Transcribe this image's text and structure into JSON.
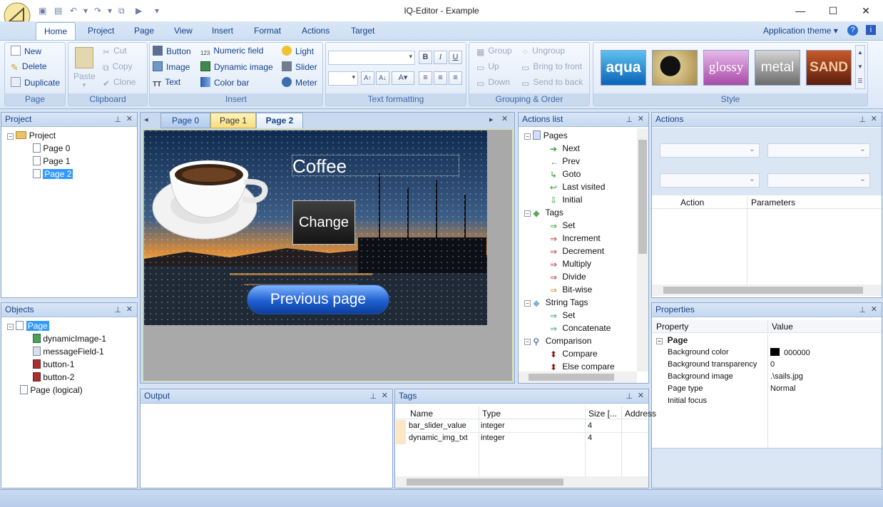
{
  "window": {
    "title": "IQ-Editor - Example",
    "min": "—",
    "max": "☐",
    "close": "✕"
  },
  "ribbon_tabs": [
    "Home",
    "Project",
    "Page",
    "View",
    "Insert",
    "Format",
    "Actions",
    "Target"
  ],
  "app_theme": "Application theme",
  "page_group": {
    "caption": "Page",
    "new": "New",
    "delete": "Delete",
    "duplicate": "Duplicate"
  },
  "clipboard_group": {
    "caption": "Clipboard",
    "paste": "Paste",
    "cut": "Cut",
    "copy": "Copy",
    "clone": "Clone"
  },
  "insert_group": {
    "caption": "Insert",
    "button": "Button",
    "image": "Image",
    "text": "Text",
    "numeric_field": "Numeric field",
    "dynamic_image": "Dynamic image",
    "color_bar": "Color bar",
    "light": "Light",
    "slider": "Slider",
    "meter": "Meter"
  },
  "text_format_group": {
    "caption": "Text formatting",
    "bold": "B",
    "italic": "I",
    "underline": "U"
  },
  "grouping_group": {
    "caption": "Grouping & Order",
    "group": "Group",
    "ungroup": "Ungroup",
    "up": "Up",
    "bring_to_front": "Bring to front",
    "down": "Down",
    "send_to_back": "Send to back"
  },
  "style_group": {
    "caption": "Style",
    "swatches": [
      "aqua",
      "",
      "glossy",
      "metal",
      "SAND"
    ]
  },
  "project_panel": {
    "title": "Project",
    "root": "Project",
    "pages": [
      "Page 0",
      "Page 1",
      "Page 2"
    ]
  },
  "objects_panel": {
    "title": "Objects",
    "page": "Page",
    "children": [
      "dynamicImage-1",
      "messageField-1",
      "button-1",
      "button-2"
    ],
    "logical": "Page (logical)"
  },
  "doc_tabs": [
    "Page 0",
    "Page 1",
    "Page 2"
  ],
  "canvas": {
    "title_text": "Coffee",
    "change_button": "Change",
    "previous_button": "Previous page"
  },
  "actions_list": {
    "title": "Actions list",
    "groups": [
      {
        "name": "Pages",
        "items": [
          "Next",
          "Prev",
          "Goto",
          "Last visited",
          "Initial"
        ]
      },
      {
        "name": "Tags",
        "items": [
          "Set",
          "Increment",
          "Decrement",
          "Multiply",
          "Divide",
          "Bit-wise"
        ]
      },
      {
        "name": "String Tags",
        "items": [
          "Set",
          "Concatenate"
        ]
      },
      {
        "name": "Comparison",
        "items": [
          "Compare",
          "Else compare"
        ]
      }
    ]
  },
  "actions_panel": {
    "title": "Actions",
    "col_action": "Action",
    "col_params": "Parameters"
  },
  "output_panel": {
    "title": "Output"
  },
  "tags_panel": {
    "title": "Tags",
    "columns": [
      "Name",
      "Type",
      "Size [...",
      "Address"
    ],
    "rows": [
      [
        "bar_slider_value",
        "integer",
        "4",
        ""
      ],
      [
        "dynamic_img_txt",
        "integer",
        "4",
        ""
      ]
    ]
  },
  "properties_panel": {
    "title": "Properties",
    "col_property": "Property",
    "col_value": "Value",
    "section": "Page",
    "rows": [
      {
        "p": "Background color",
        "v": "000000"
      },
      {
        "p": "Background transparency",
        "v": "0"
      },
      {
        "p": "Background image",
        "v": ".\\sails.jpg"
      },
      {
        "p": "Page type",
        "v": "Normal"
      },
      {
        "p": "Initial focus",
        "v": ""
      }
    ]
  },
  "colors": {
    "accent": "#15428b",
    "selection": "#3399ff",
    "panel_border": "#8fa9cd"
  }
}
